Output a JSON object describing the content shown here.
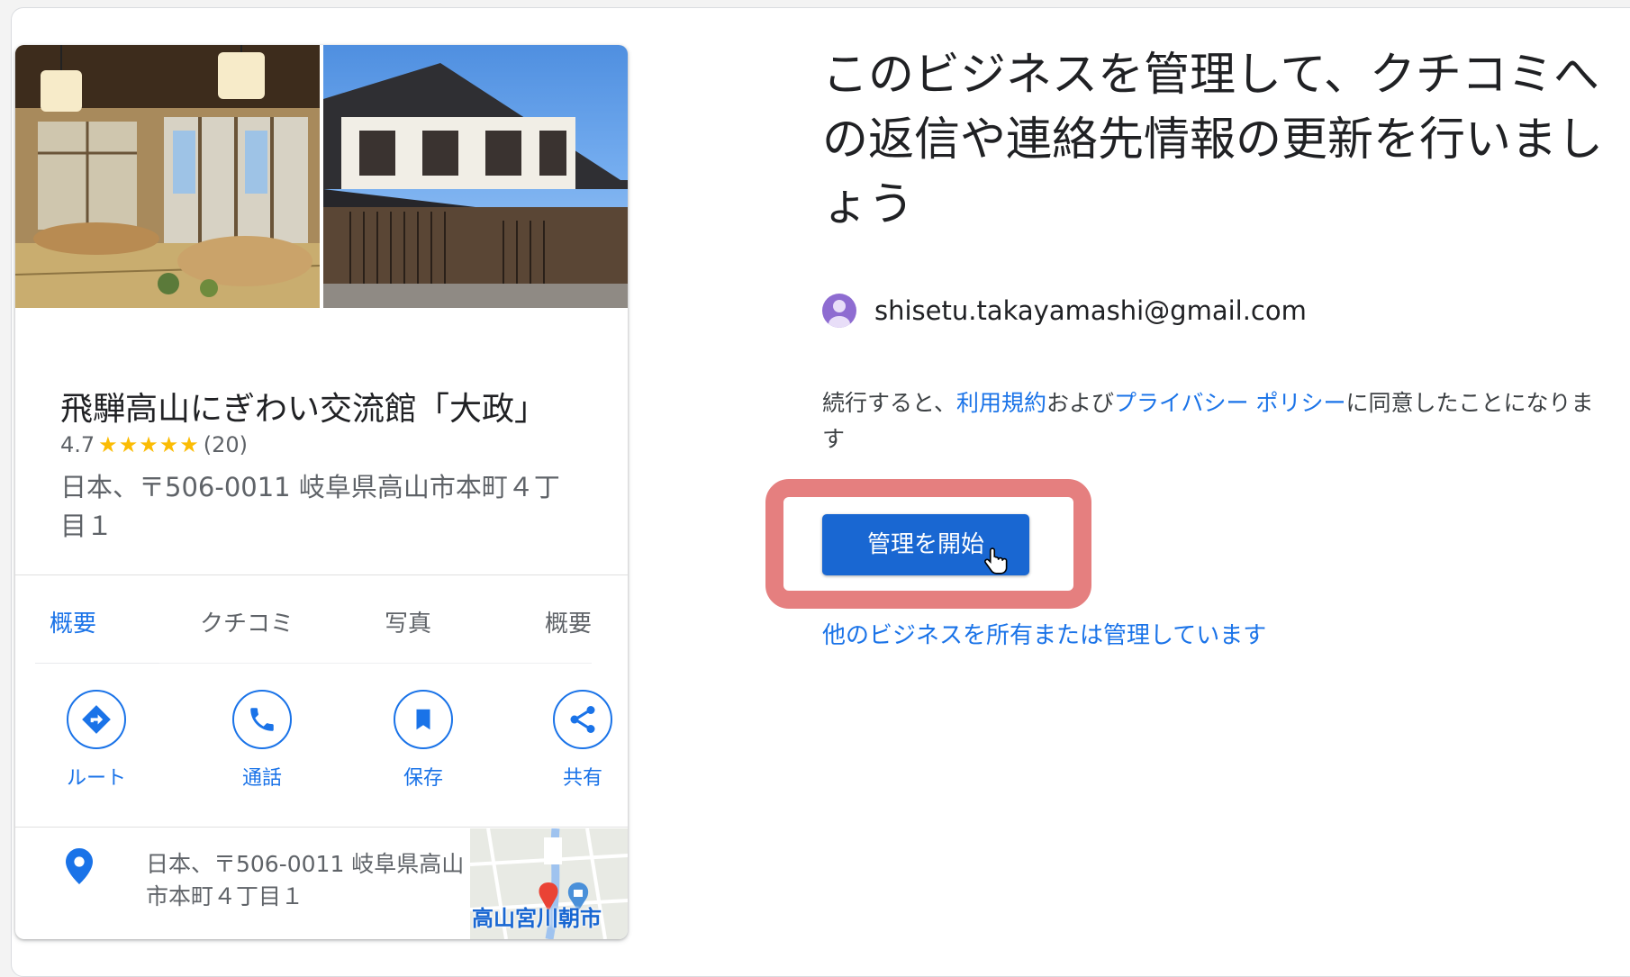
{
  "business": {
    "name": "飛騨高山にぎわい交流館「大政」",
    "rating": "4.7",
    "stars": "★★★★★",
    "review_count": "(20)",
    "address": "日本、〒506-0011 岐阜県高山市本町４丁目１"
  },
  "tabs": [
    "概要",
    "クチコミ",
    "写真",
    "概要"
  ],
  "actions": [
    {
      "label": "ルート",
      "icon": "directions-icon"
    },
    {
      "label": "通話",
      "icon": "phone-icon"
    },
    {
      "label": "保存",
      "icon": "bookmark-icon"
    },
    {
      "label": "共有",
      "icon": "share-icon"
    }
  ],
  "address_row": {
    "text": "日本、〒506-0011 岐阜県高山市本町４丁目１",
    "map_label": "高山宮川朝市"
  },
  "claim": {
    "headline": "このビジネスを管理して、クチコミへの返信や連絡先情報の更新を行いましょう",
    "email": "shisetu.takayamashi@gmail.com",
    "consent_prefix": "続行すると、",
    "terms_link": "利用規約",
    "consent_and": "および",
    "privacy_link": "プライバシー ポリシー",
    "consent_suffix": "に同意したことになります",
    "primary_button": "管理を開始",
    "secondary_link": "他のビジネスを所有または管理しています"
  },
  "colors": {
    "accent": "#1a73e8",
    "button": "#1967d2",
    "highlight": "#e57f7f",
    "star": "#fbbc04"
  }
}
